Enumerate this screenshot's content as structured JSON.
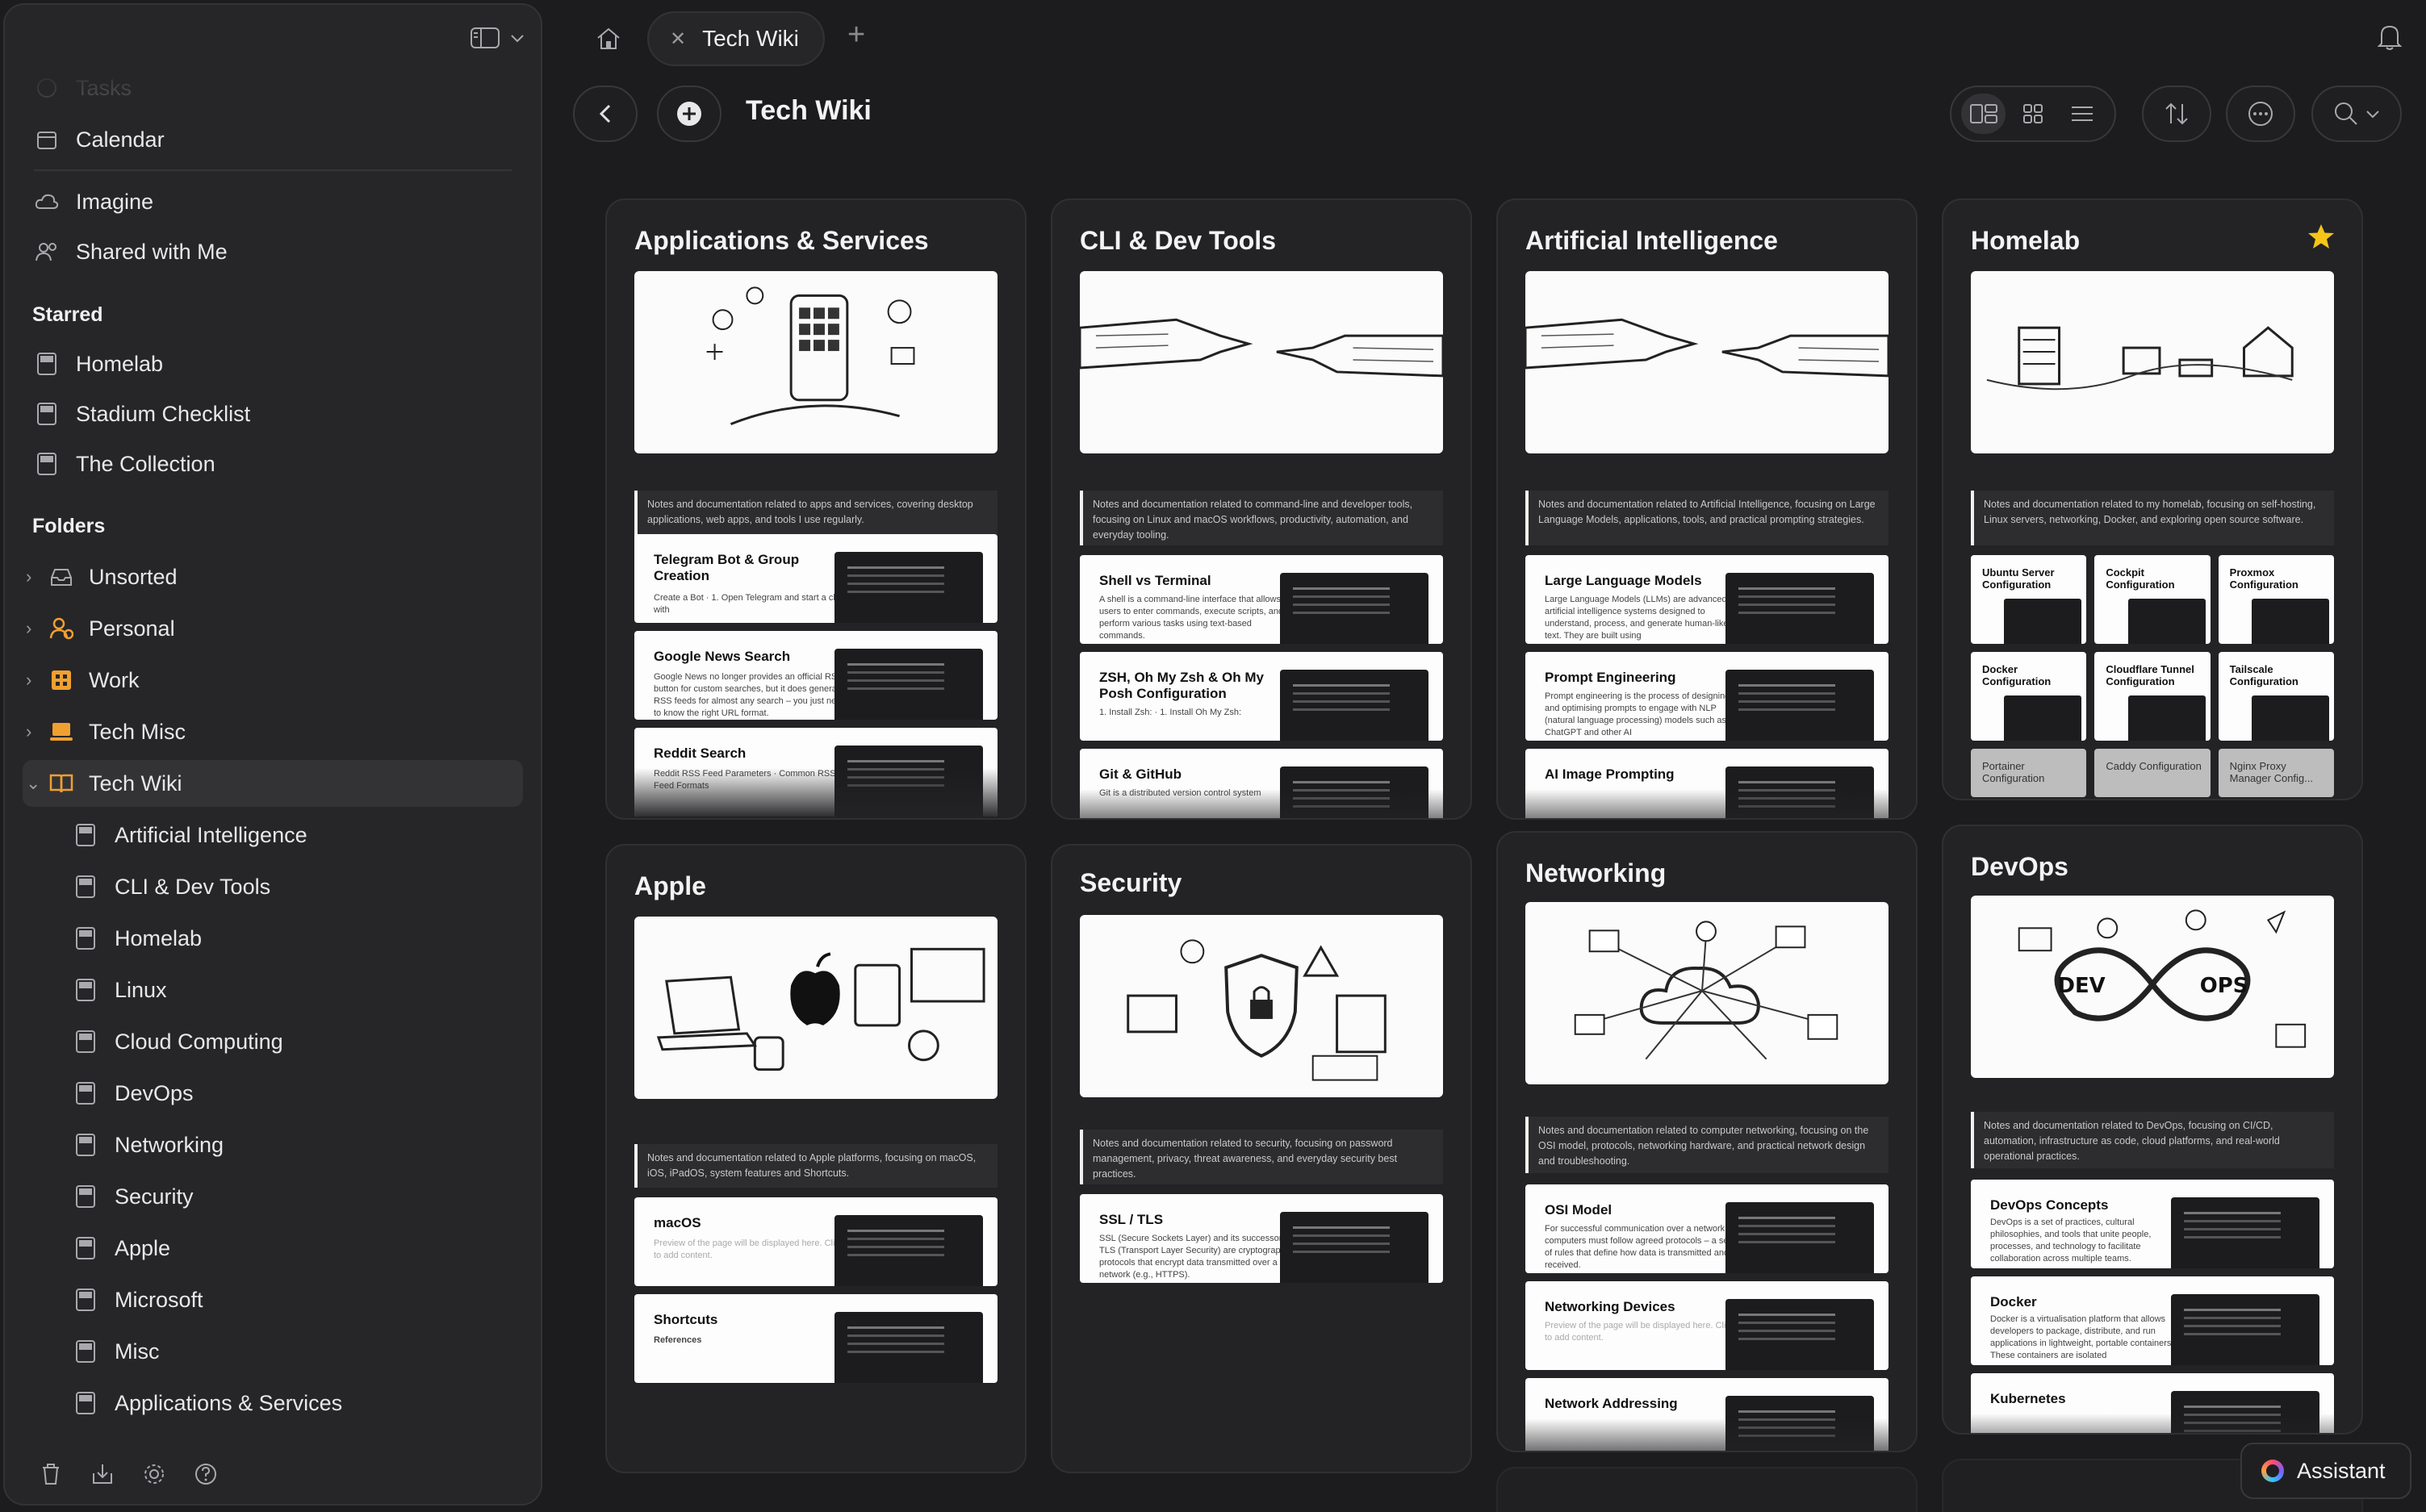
{
  "sidebar": {
    "faded_item": "Tasks",
    "calendar": "Calendar",
    "imagine": "Imagine",
    "shared": "Shared with Me",
    "starred_heading": "Starred",
    "starred": [
      "Homelab",
      "Stadium Checklist",
      "The Collection"
    ],
    "folders_heading": "Folders",
    "folders": [
      "Unsorted",
      "Personal",
      "Work",
      "Tech Misc",
      "Tech Wiki"
    ],
    "subfolders": [
      "Artificial Intelligence",
      "CLI & Dev Tools",
      "Homelab",
      "Linux",
      "Cloud Computing",
      "DevOps",
      "Networking",
      "Security",
      "Apple",
      "Microsoft",
      "Misc",
      "Applications & Services"
    ]
  },
  "tabs": {
    "active": "Tech Wiki"
  },
  "header": {
    "title": "Tech Wiki"
  },
  "assistant": {
    "label": "Assistant"
  },
  "cards": {
    "apps": {
      "title": "Applications & Services",
      "desc": "Notes and documentation related to apps and services, covering desktop applications, web apps, and tools I use regularly.",
      "notes": [
        {
          "title": "Telegram Bot & Group Creation",
          "body": "Create a Bot · 1. Open Telegram and start a chat with"
        },
        {
          "title": "Google News Search",
          "body": "Google News no longer provides an official RSS button for custom searches, but it does generate RSS feeds for almost any search – you just need to know the right URL format."
        },
        {
          "title": "Reddit Search",
          "body": "Reddit RSS Feed Parameters · Common RSS Feed Formats"
        }
      ]
    },
    "cli": {
      "title": "CLI & Dev Tools",
      "desc": "Notes and documentation related to command-line and developer tools, focusing on Linux and macOS workflows, productivity, automation, and everyday tooling.",
      "notes": [
        {
          "title": "Shell vs Terminal",
          "body": "A shell is a command-line interface that allows users to enter commands, execute scripts, and perform various tasks using text-based commands."
        },
        {
          "title": "ZSH, Oh My Zsh & Oh My Posh Configuration",
          "body": "1. Install Zsh: · 1. Install Oh My Zsh:"
        },
        {
          "title": "Git & GitHub",
          "body": "Git is a distributed version control system"
        }
      ]
    },
    "ai": {
      "title": "Artificial Intelligence",
      "desc": "Notes and documentation related to Artificial Intelligence, focusing on Large Language Models, applications, tools, and practical prompting strategies.",
      "notes": [
        {
          "title": "Large Language Models",
          "body": "Large Language Models (LLMs) are advanced artificial intelligence systems designed to understand, process, and generate human-like text. They are built using"
        },
        {
          "title": "Prompt Engineering",
          "body": "Prompt engineering is the process of designing and optimising prompts to engage with NLP (natural language processing) models such as ChatGPT and other AI"
        },
        {
          "title": "AI Image Prompting",
          "body": ""
        }
      ]
    },
    "homelab": {
      "title": "Homelab",
      "desc": "Notes and documentation related to my homelab, focusing on self-hosting, Linux servers, networking, Docker, and exploring open source software.",
      "minis": [
        "Ubuntu Server Configuration",
        "Cockpit Configuration",
        "Proxmox Configuration",
        "Docker Configuration",
        "Cloudflare Tunnel Configuration",
        "Tailscale Configuration",
        "Portainer Configuration",
        "Caddy Configuration",
        "Nginx Proxy Manager Config..."
      ]
    },
    "apple": {
      "title": "Apple",
      "desc": "Notes and documentation related to Apple platforms, focusing on macOS, iOS, iPadOS, system features and Shortcuts.",
      "notes": [
        {
          "title": "macOS",
          "body": "Preview of the page will be displayed here. Click to add content."
        },
        {
          "title": "Shortcuts",
          "body": "References"
        }
      ]
    },
    "security": {
      "title": "Security",
      "desc": "Notes and documentation related to security, focusing on password management, privacy, threat awareness, and everyday security best practices.",
      "notes": [
        {
          "title": "SSL / TLS",
          "body": "SSL (Secure Sockets Layer) and its successor TLS (Transport Layer Security) are cryptographic protocols that encrypt data transmitted over a network (e.g., HTTPS)."
        }
      ]
    },
    "networking": {
      "title": "Networking",
      "desc": "Notes and documentation related to computer networking, focusing on the OSI model, protocols, networking hardware, and practical network design and troubleshooting.",
      "notes": [
        {
          "title": "OSI Model",
          "body": "For successful communication over a network, computers must follow agreed protocols – a set of rules that define how data is transmitted and received."
        },
        {
          "title": "Networking Devices",
          "body": "Preview of the page will be displayed here. Click to add content."
        },
        {
          "title": "Network Addressing",
          "body": ""
        }
      ]
    },
    "devops": {
      "title": "DevOps",
      "desc": "Notes and documentation related to DevOps, focusing on CI/CD, automation, infrastructure as code, cloud platforms, and real-world operational practices.",
      "notes": [
        {
          "title": "DevOps Concepts",
          "body": "DevOps is a set of practices, cultural philosophies, and tools that unite people, processes, and technology to facilitate collaboration across multiple teams."
        },
        {
          "title": "Docker",
          "body": "Docker is a virtualisation platform that allows developers to package, distribute, and run applications in lightweight, portable containers. These containers are isolated"
        },
        {
          "title": "Kubernetes",
          "body": ""
        }
      ]
    }
  },
  "colors": {
    "background": "#1c1c1e",
    "sidebar": "#262628",
    "card": "#232325",
    "star": "#f5c518",
    "text": "#e6e6e6"
  }
}
